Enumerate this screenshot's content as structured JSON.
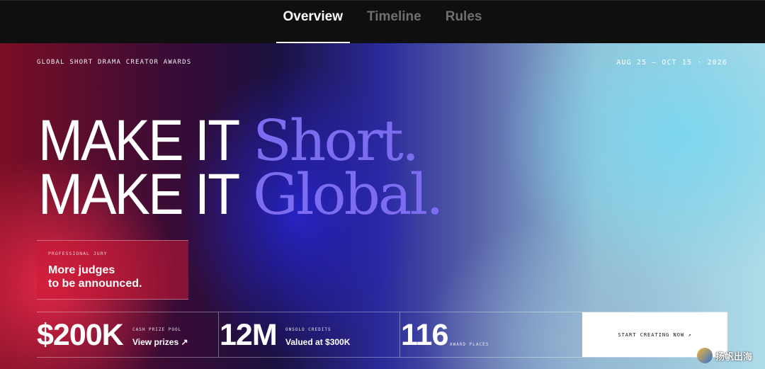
{
  "nav": {
    "tabs": [
      {
        "label": "Overview",
        "active": true
      },
      {
        "label": "Timeline",
        "active": false
      },
      {
        "label": "Rules",
        "active": false
      }
    ]
  },
  "hero": {
    "brand": "GLOBAL SHORT DRAMA CREATOR AWARDS",
    "dates": "AUG 25 — OCT 15 · 2026",
    "headline": {
      "line1_sans": "MAKE IT ",
      "line1_serif": "Short.",
      "line2_sans": "MAKE IT ",
      "line2_serif": "Global."
    },
    "jury": {
      "label": "PROFESSIONAL JURY",
      "line1": "More judges",
      "line2": "to be announced."
    }
  },
  "stats": [
    {
      "big": "$200K",
      "caption": "CASH PRIZE POOL",
      "sub": "View prizes ↗"
    },
    {
      "big": "12M",
      "caption": "ONSOLO CREDITS",
      "sub": "Valued at $300K"
    },
    {
      "big": "116",
      "caption": "AWARD PLACES",
      "sub": ""
    }
  ],
  "cta": {
    "label": "START CREATING NOW ↗"
  },
  "watermark": {
    "text": "扬帆出海"
  },
  "colors": {
    "accent_purple": "#7b6cf0",
    "red_glow": "#e62846",
    "cyan_glow": "#78d7f0"
  }
}
